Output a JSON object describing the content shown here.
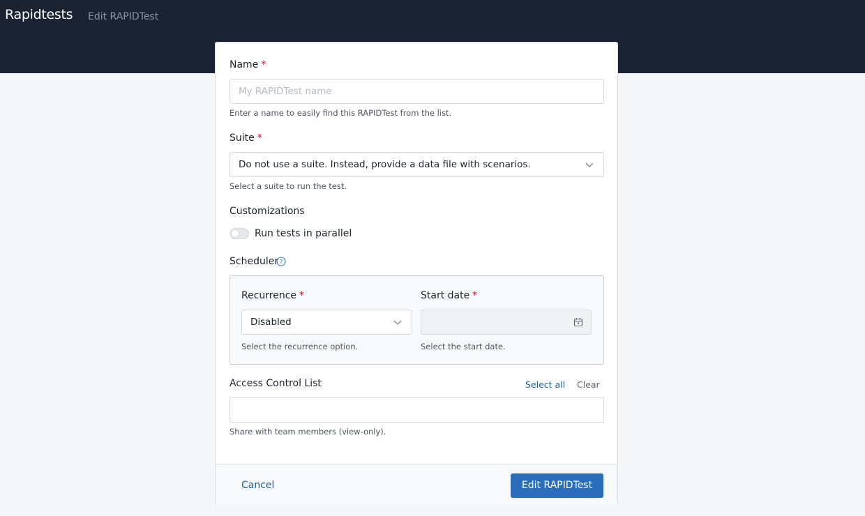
{
  "header": {
    "brand": "Rapidtests",
    "breadcrumb": "Edit RAPIDTest"
  },
  "form": {
    "name": {
      "label": "Name",
      "required_mark": "*",
      "placeholder": "My RAPIDTest name",
      "help": "Enter a name to easily find this RAPIDTest from the list."
    },
    "suite": {
      "label": "Suite",
      "required_mark": "*",
      "selected": "Do not use a suite. Instead, provide a data file with scenarios.",
      "help": "Select a suite to run the test."
    },
    "customizations": {
      "label": "Customizations",
      "toggle_label": "Run tests in parallel",
      "toggle_on": false
    },
    "scheduler": {
      "label": "Scheduler",
      "help_icon": "question-circle-icon",
      "recurrence": {
        "label": "Recurrence",
        "required_mark": "*",
        "selected": "Disabled",
        "help": "Select the recurrence option."
      },
      "start_date": {
        "label": "Start date",
        "required_mark": "*",
        "value": "",
        "help": "Select the start date.",
        "icon": "calendar-icon"
      }
    },
    "acl": {
      "label": "Access Control List",
      "select_all": "Select all",
      "clear": "Clear",
      "value": "",
      "help": "Share with team members (view-only)."
    }
  },
  "footer": {
    "cancel": "Cancel",
    "submit": "Edit RAPIDTest"
  },
  "colors": {
    "topbar": "#1b2332",
    "primary": "#2a6ebb",
    "link": "#1f5fa8",
    "required": "#c8102e"
  }
}
